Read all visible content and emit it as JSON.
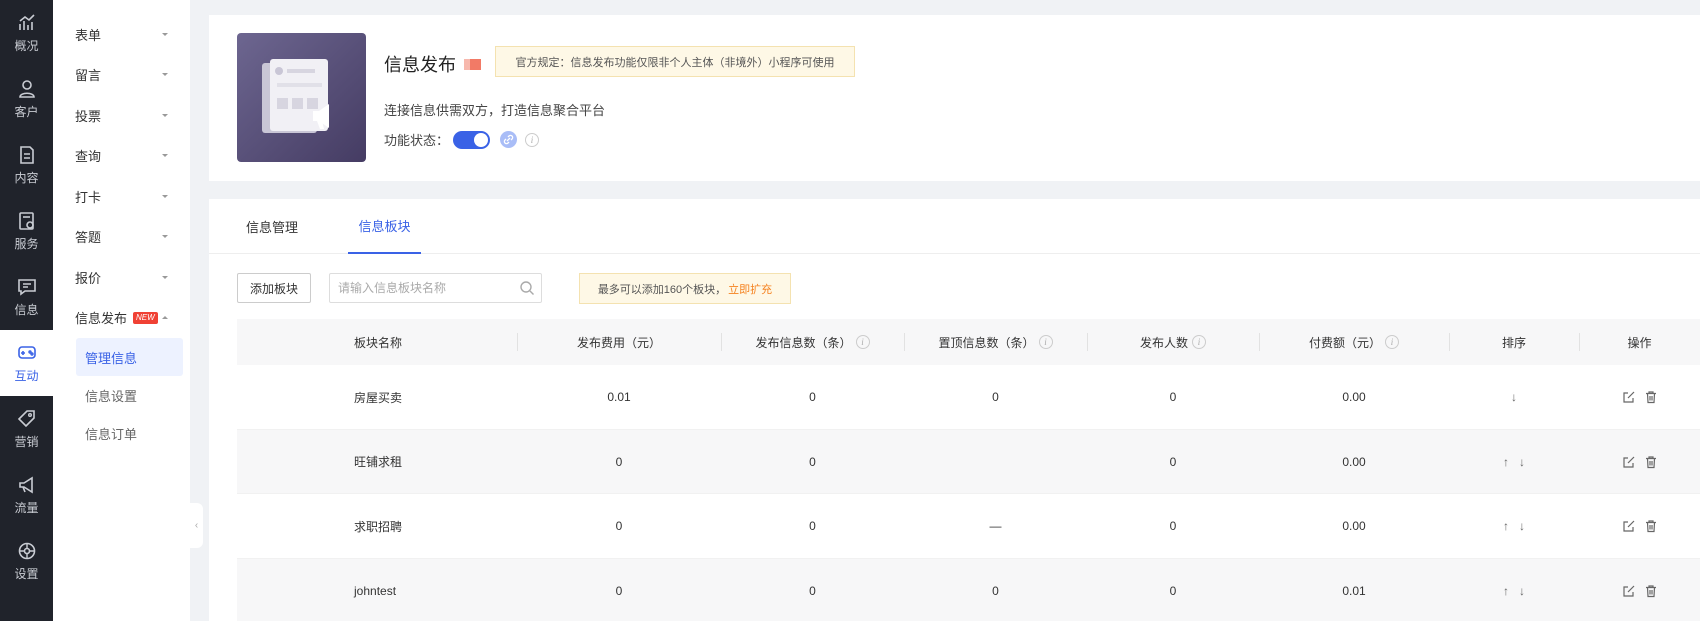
{
  "leftnav": [
    {
      "label": "概况",
      "icon": "chart-trend-icon",
      "active": false
    },
    {
      "label": "客户",
      "icon": "user-icon",
      "active": false
    },
    {
      "label": "内容",
      "icon": "document-icon",
      "active": false
    },
    {
      "label": "服务",
      "icon": "service-icon",
      "active": false
    },
    {
      "label": "信息",
      "icon": "message-icon",
      "active": false
    },
    {
      "label": "互动",
      "icon": "gamepad-icon",
      "active": true
    },
    {
      "label": "营销",
      "icon": "tag-icon",
      "active": false
    },
    {
      "label": "流量",
      "icon": "megaphone-icon",
      "active": false
    },
    {
      "label": "设置",
      "icon": "settings-icon",
      "active": false
    }
  ],
  "subnav": {
    "items": [
      {
        "label": "表单"
      },
      {
        "label": "留言"
      },
      {
        "label": "投票"
      },
      {
        "label": "查询"
      },
      {
        "label": "打卡"
      },
      {
        "label": "答题"
      },
      {
        "label": "报价"
      },
      {
        "label": "信息发布",
        "badge": "NEW"
      }
    ],
    "children": [
      {
        "label": "管理信息",
        "active": true
      },
      {
        "label": "信息设置",
        "active": false
      },
      {
        "label": "信息订单",
        "active": false
      }
    ]
  },
  "app": {
    "title": "信息发布",
    "notice": "官方规定：信息发布功能仅限非个人主体（非境外）小程序可使用",
    "description": "连接信息供需双方，打造信息聚合平台",
    "status_label": "功能状态：",
    "enabled": true,
    "info_mark": "i"
  },
  "tabs": [
    {
      "label": "信息管理",
      "active": false
    },
    {
      "label": "信息板块",
      "active": true
    }
  ],
  "toolbar": {
    "add_label": "添加板块",
    "search_placeholder": "请输入信息板块名称",
    "limit_text": "最多可以添加160个板块，",
    "limit_link": "立即扩充"
  },
  "table": {
    "info_mark": "i",
    "headers": [
      "板块名称",
      "发布费用（元）",
      "发布信息数（条）",
      "置顶信息数（条）",
      "发布人数",
      "付费额（元）",
      "排序",
      "操作"
    ],
    "rows": [
      {
        "name": "房屋买卖",
        "fee": "0.01",
        "posts": "0",
        "pinned": "0",
        "publishers": "0",
        "paid": "0.00",
        "sort": [
          "↓"
        ]
      },
      {
        "name": "旺铺求租",
        "fee": "0",
        "posts": "0",
        "pinned": "",
        "publishers": "0",
        "paid": "0.00",
        "sort": [
          "↑",
          "↓"
        ]
      },
      {
        "name": "求职招聘",
        "fee": "0",
        "posts": "0",
        "pinned": "—",
        "publishers": "0",
        "paid": "0.00",
        "sort": [
          "↑",
          "↓"
        ]
      },
      {
        "name": "johntest",
        "fee": "0",
        "posts": "0",
        "pinned": "0",
        "publishers": "0",
        "paid": "0.01",
        "sort": [
          "↑",
          "↓"
        ]
      }
    ]
  },
  "colors": {
    "accent": "#3a62e6",
    "nav_bg": "#20232b",
    "warn_link": "#f5821f",
    "badge": "#f04134"
  }
}
